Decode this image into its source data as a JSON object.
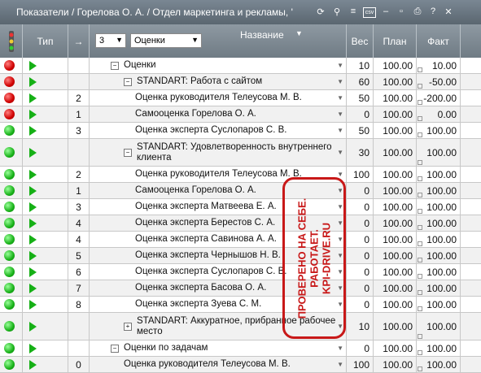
{
  "title": "Показатели / Горелова О. А. / Отдел маркетинга и рекламы, '",
  "title_icons": [
    "refresh-icon",
    "search-icon",
    "list-icon",
    "csv-icon",
    "minimize-icon",
    "restore-icon",
    "print-icon",
    "help-icon",
    "close-icon"
  ],
  "header": {
    "type_label": "Тип",
    "arrow_label": "→",
    "level_select": "3",
    "filter_select": "Оценки",
    "name_label": "Название",
    "weight_label": "Вес",
    "plan_label": "План",
    "fact_label": "Факт"
  },
  "rows": [
    {
      "status": "red",
      "num": "",
      "indent": 1,
      "expander": "minus",
      "name": "Оценки",
      "weight": "10",
      "plan": "100.00",
      "fact": "10.00"
    },
    {
      "status": "red",
      "num": "",
      "indent": 2,
      "expander": "minus",
      "name": "STANDART: Работа с сайтом",
      "weight": "60",
      "plan": "100.00",
      "fact": "-50.00"
    },
    {
      "status": "red",
      "num": "2",
      "indent": 3,
      "expander": "",
      "name": "Оценка руководителя Телеусова М. В.",
      "weight": "50",
      "plan": "100.00",
      "fact": "-200.00"
    },
    {
      "status": "red",
      "num": "1",
      "indent": 3,
      "expander": "",
      "name": "Самооценка Горелова О. А.",
      "weight": "0",
      "plan": "100.00",
      "fact": "0.00"
    },
    {
      "status": "green",
      "num": "3",
      "indent": 3,
      "expander": "",
      "name": "Оценка эксперта Суслопаров С. В.",
      "weight": "50",
      "plan": "100.00",
      "fact": "100.00"
    },
    {
      "status": "green",
      "num": "",
      "indent": 2,
      "expander": "minus",
      "name": "STANDART: Удовлетворенность внутреннего клиента",
      "weight": "30",
      "plan": "100.00",
      "fact": "100.00"
    },
    {
      "status": "green",
      "num": "2",
      "indent": 3,
      "expander": "",
      "name": "Оценка руководителя Телеусова М. В.",
      "weight": "100",
      "plan": "100.00",
      "fact": "100.00"
    },
    {
      "status": "green",
      "num": "1",
      "indent": 3,
      "expander": "",
      "name": "Самооценка Горелова О. А.",
      "weight": "0",
      "plan": "100.00",
      "fact": "100.00"
    },
    {
      "status": "green",
      "num": "3",
      "indent": 3,
      "expander": "",
      "name": "Оценка эксперта Матвеева Е. А.",
      "weight": "0",
      "plan": "100.00",
      "fact": "100.00"
    },
    {
      "status": "green",
      "num": "4",
      "indent": 3,
      "expander": "",
      "name": "Оценка эксперта Берестов С. А.",
      "weight": "0",
      "plan": "100.00",
      "fact": "100.00"
    },
    {
      "status": "green",
      "num": "4",
      "indent": 3,
      "expander": "",
      "name": "Оценка эксперта Савинова А. А.",
      "weight": "0",
      "plan": "100.00",
      "fact": "100.00"
    },
    {
      "status": "green",
      "num": "5",
      "indent": 3,
      "expander": "",
      "name": "Оценка эксперта Чернышов Н. В.",
      "weight": "0",
      "plan": "100.00",
      "fact": "100.00"
    },
    {
      "status": "green",
      "num": "6",
      "indent": 3,
      "expander": "",
      "name": "Оценка эксперта Суслопаров С. В.",
      "weight": "0",
      "plan": "100.00",
      "fact": "100.00"
    },
    {
      "status": "green",
      "num": "7",
      "indent": 3,
      "expander": "",
      "name": "Оценка эксперта Басова О. А.",
      "weight": "0",
      "plan": "100.00",
      "fact": "100.00"
    },
    {
      "status": "green",
      "num": "8",
      "indent": 3,
      "expander": "",
      "name": "Оценка эксперта Зуева С. М.",
      "weight": "0",
      "plan": "100.00",
      "fact": "100.00"
    },
    {
      "status": "green",
      "num": "",
      "indent": 2,
      "expander": "plus",
      "name": "STANDART: Аккуратное, прибранное рабочее место",
      "weight": "10",
      "plan": "100.00",
      "fact": "100.00"
    },
    {
      "status": "green",
      "num": "",
      "indent": 1,
      "expander": "minus",
      "name": "Оценки по задачам",
      "weight": "0",
      "plan": "100.00",
      "fact": "100.00"
    },
    {
      "status": "green",
      "num": "0",
      "indent": 2,
      "expander": "",
      "name": "Оценка руководителя Телеусова М. В.",
      "weight": "100",
      "plan": "100.00",
      "fact": "100.00"
    }
  ],
  "stamp": {
    "line1": "ПРОВЕРЕНО НА СЕБЕ.",
    "line2": "РАБОТАЕТ.",
    "line3": "KPI-DRIVE.RU"
  },
  "colors": {
    "status_red": "#d00000",
    "status_green": "#19b219",
    "stamp": "#c81818"
  }
}
